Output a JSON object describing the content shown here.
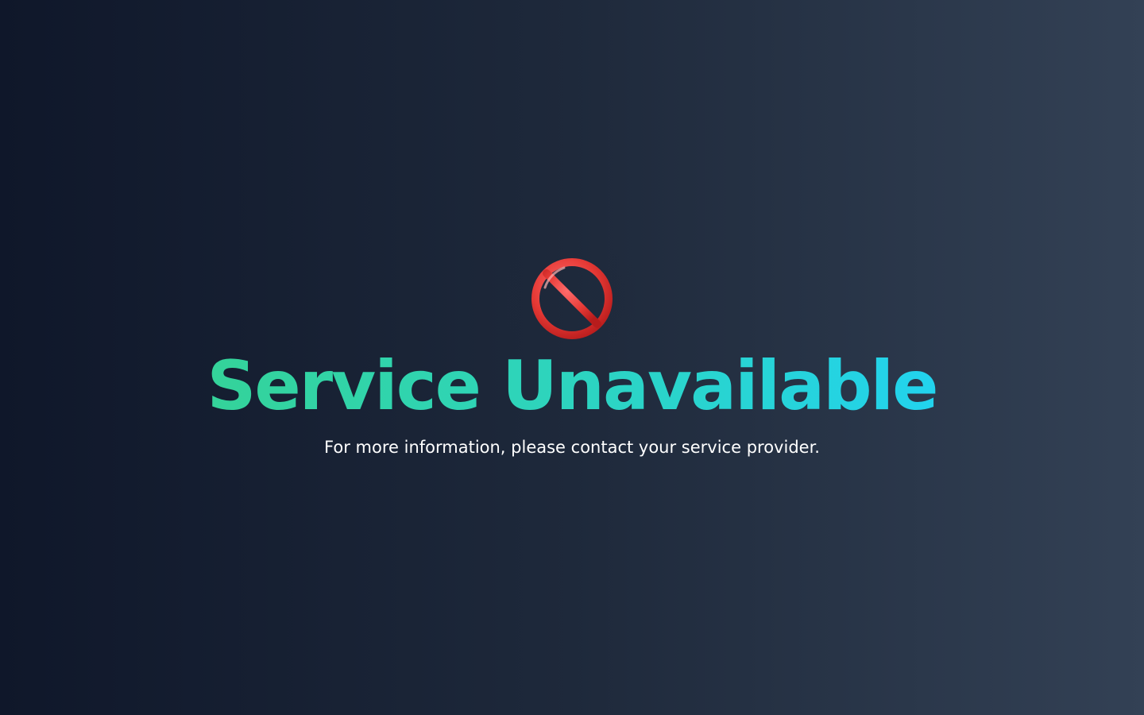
{
  "page": {
    "title": "Service Unavailable",
    "message": "For more information, please contact your service provider."
  },
  "icon": {
    "name": "prohibited-icon",
    "color": "#e53935"
  },
  "colors": {
    "background_start": "#0f172a",
    "background_end": "#334155",
    "title_gradient_start": "#34d399",
    "title_gradient_end": "#22d3ee",
    "message_text": "#ffffff"
  }
}
